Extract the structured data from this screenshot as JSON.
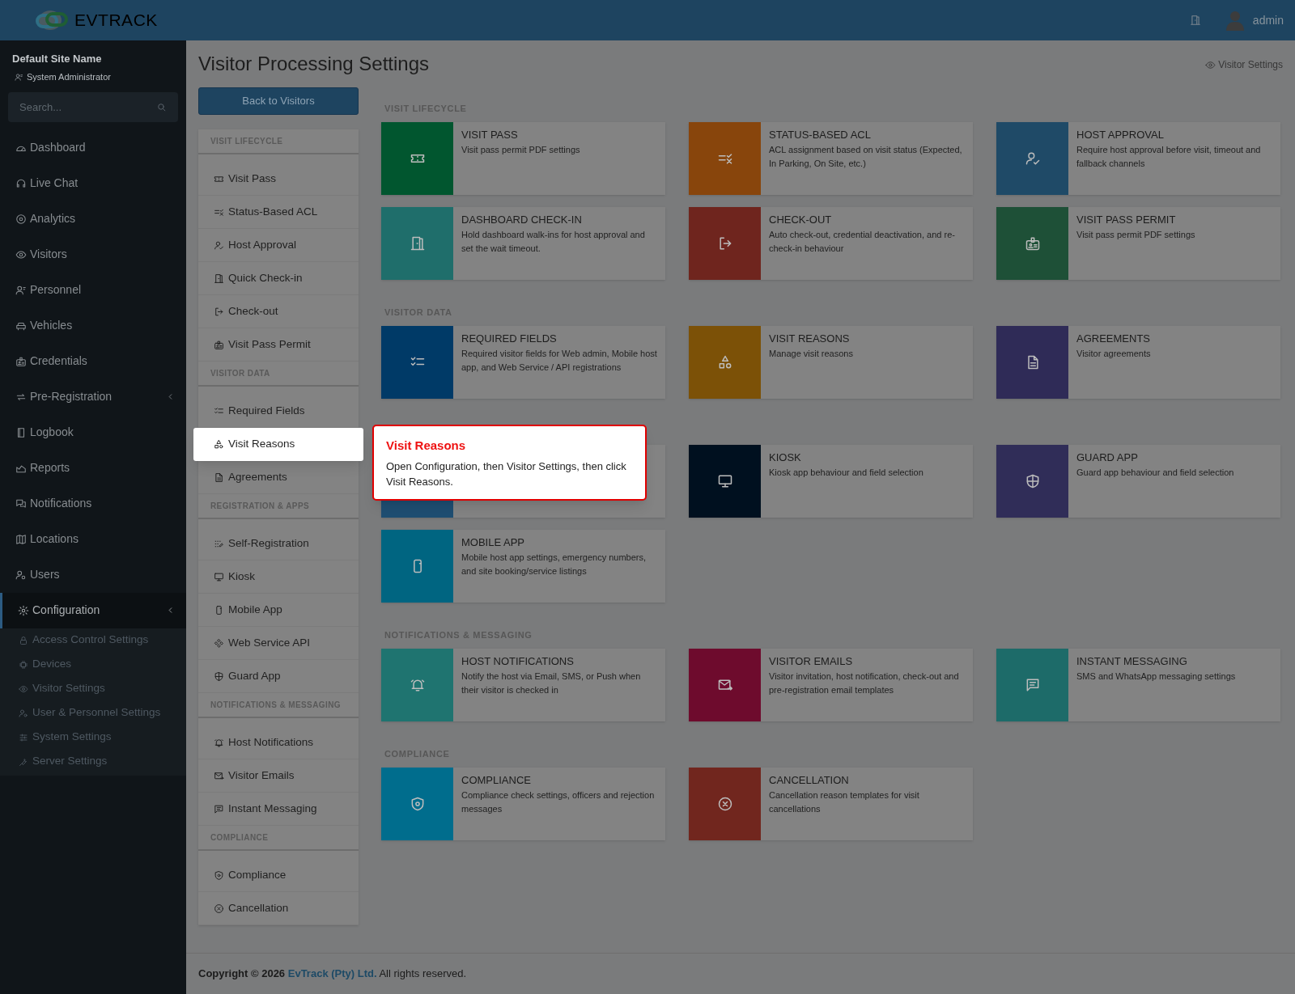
{
  "topbar": {
    "brand": "**EV**TRACK",
    "user": "admin"
  },
  "sidebar": {
    "site_name": "Default Site Name",
    "role": "System Administrator",
    "search": {
      "placeholder": "Search..."
    },
    "items": [
      {
        "label": "Dashboard",
        "submenu": false,
        "selected": false
      },
      {
        "label": "Live Chat",
        "submenu": false,
        "selected": false
      },
      {
        "label": "Analytics",
        "submenu": false,
        "selected": false
      },
      {
        "label": "Visitors",
        "submenu": false,
        "selected": false
      },
      {
        "label": "Personnel",
        "submenu": false,
        "selected": false
      },
      {
        "label": "Vehicles",
        "submenu": false,
        "selected": false
      },
      {
        "label": "Credentials",
        "submenu": false,
        "selected": false
      },
      {
        "label": "Pre-Registration",
        "submenu": true,
        "selected": false
      },
      {
        "label": "Logbook",
        "submenu": false,
        "selected": false
      },
      {
        "label": "Reports",
        "submenu": false,
        "selected": false
      },
      {
        "label": "Notifications",
        "submenu": false,
        "selected": false
      },
      {
        "label": "Locations",
        "submenu": false,
        "selected": false
      },
      {
        "label": "Users",
        "submenu": false,
        "selected": false
      },
      {
        "label": "Configuration",
        "submenu": true,
        "selected": true,
        "children": [
          "Access Control Settings",
          "Devices",
          "Visitor Settings",
          "User & Personnel Settings",
          "System Settings",
          "Server Settings"
        ]
      }
    ]
  },
  "page": {
    "title": "Visitor Processing Settings",
    "breadcrumb": "Visitor Settings",
    "back_button": "Back to Visitors"
  },
  "settings_menu": [
    {
      "title": "VISIT LIFECYCLE",
      "items": [
        {
          "label": "Visit Pass",
          "highlighted": false
        },
        {
          "label": "Status-Based ACL",
          "highlighted": false
        },
        {
          "label": "Host Approval",
          "highlighted": false
        },
        {
          "label": "Quick Check-in",
          "highlighted": false
        },
        {
          "label": "Check-out",
          "highlighted": false
        },
        {
          "label": "Visit Pass Permit",
          "highlighted": false
        }
      ]
    },
    {
      "title": "VISITOR DATA",
      "items": [
        {
          "label": "Required Fields",
          "highlighted": false
        },
        {
          "label": "Visit Reasons",
          "highlighted": true
        },
        {
          "label": "Agreements",
          "highlighted": false
        }
      ]
    },
    {
      "title": "REGISTRATION & APPS",
      "items": [
        {
          "label": "Self-Registration",
          "highlighted": false
        },
        {
          "label": "Kiosk",
          "highlighted": false
        },
        {
          "label": "Mobile App",
          "highlighted": false
        },
        {
          "label": "Web Service API",
          "highlighted": false
        },
        {
          "label": "Guard App",
          "highlighted": false
        }
      ]
    },
    {
      "title": "NOTIFICATIONS & MESSAGING",
      "items": [
        {
          "label": "Host Notifications",
          "highlighted": false
        },
        {
          "label": "Visitor Emails",
          "highlighted": false
        },
        {
          "label": "Instant Messaging",
          "highlighted": false
        }
      ]
    },
    {
      "title": "COMPLIANCE",
      "items": [
        {
          "label": "Compliance",
          "highlighted": false
        },
        {
          "label": "Cancellation",
          "highlighted": false
        }
      ]
    }
  ],
  "card_sections": [
    {
      "title": "VISIT LIFECYCLE",
      "cards": [
        {
          "title": "VISIT PASS",
          "description": "Visit pass permit PDF settings",
          "color": "#01562f"
        },
        {
          "title": "STATUS-BASED ACL",
          "description": "ACL assignment based on visit status (Expected, In Parking, On Site, etc.)",
          "color": "#88450c"
        },
        {
          "title": "HOST APPROVAL",
          "description": "Require host approval before visit, timeout and fallback channels",
          "color": "#1f4a67"
        },
        {
          "title": "DASHBOARD CHECK-IN",
          "description": "Hold dashboard walk-ins for host approval and set the wait timeout.",
          "color": "#1f6e6b"
        },
        {
          "title": "CHECK-OUT",
          "description": "Auto check-out, credential deactivation, and re-check-in behaviour",
          "color": "#6f251e"
        },
        {
          "title": "VISIT PASS PERMIT",
          "description": "Visit pass permit PDF settings",
          "color": "#1e5037"
        }
      ]
    },
    {
      "title": "VISITOR DATA",
      "cards": [
        {
          "title": "REQUIRED FIELDS",
          "description": "Required visitor fields for Web admin, Mobile host app, and Web Service / API registrations",
          "color": "#003a67"
        },
        {
          "title": "VISIT REASONS",
          "description": "Manage visit reasons",
          "color": "#7c5107"
        },
        {
          "title": "AGREEMENTS",
          "description": "Visitor agreements",
          "color": "#2f2b57"
        }
      ]
    },
    {
      "cards": [
        {
          "color": "#1f4e72"
        },
        {
          "title": "KIOSK",
          "description": "Kiosk app behaviour and field selection",
          "color": "#00101f"
        },
        {
          "title": "GUARD APP",
          "description": "Guard app behaviour and field selection",
          "color": "#302d58"
        },
        {
          "title": "MOBILE APP",
          "description": "Mobile host app settings, emergency numbers, and site booking/service listings",
          "color": "#006581"
        }
      ]
    },
    {
      "title": "NOTIFICATIONS & MESSAGING",
      "cards": [
        {
          "title": "HOST NOTIFICATIONS",
          "description": "Notify the host via Email, SMS, or Push when their visitor is checked in",
          "color": "#1f7470"
        },
        {
          "title": "VISITOR EMAILS",
          "description": "Visitor invitation, host notification, check-out and pre-registration email templates",
          "color": "#6e0b2d"
        },
        {
          "title": "INSTANT MESSAGING",
          "description": "SMS and WhatsApp messaging settings",
          "color": "#1d6b69"
        }
      ]
    },
    {
      "title": "COMPLIANCE",
      "cards": [
        {
          "title": "COMPLIANCE",
          "description": "Compliance check settings, officers and rejection messages",
          "color": "#006d8d"
        },
        {
          "title": "CANCELLATION",
          "description": "Cancellation reason templates for visit cancellations",
          "color": "#71261e"
        }
      ]
    }
  ],
  "tooltip": {
    "title": "Visit Reasons",
    "text": "Open Configuration, then Visitor Settings, then click Visit Reasons."
  },
  "footer": {
    "prefix": "Copyright © 2026",
    "link": "EvTrack (Pty) Ltd.",
    "suffix": "All rights reserved."
  }
}
